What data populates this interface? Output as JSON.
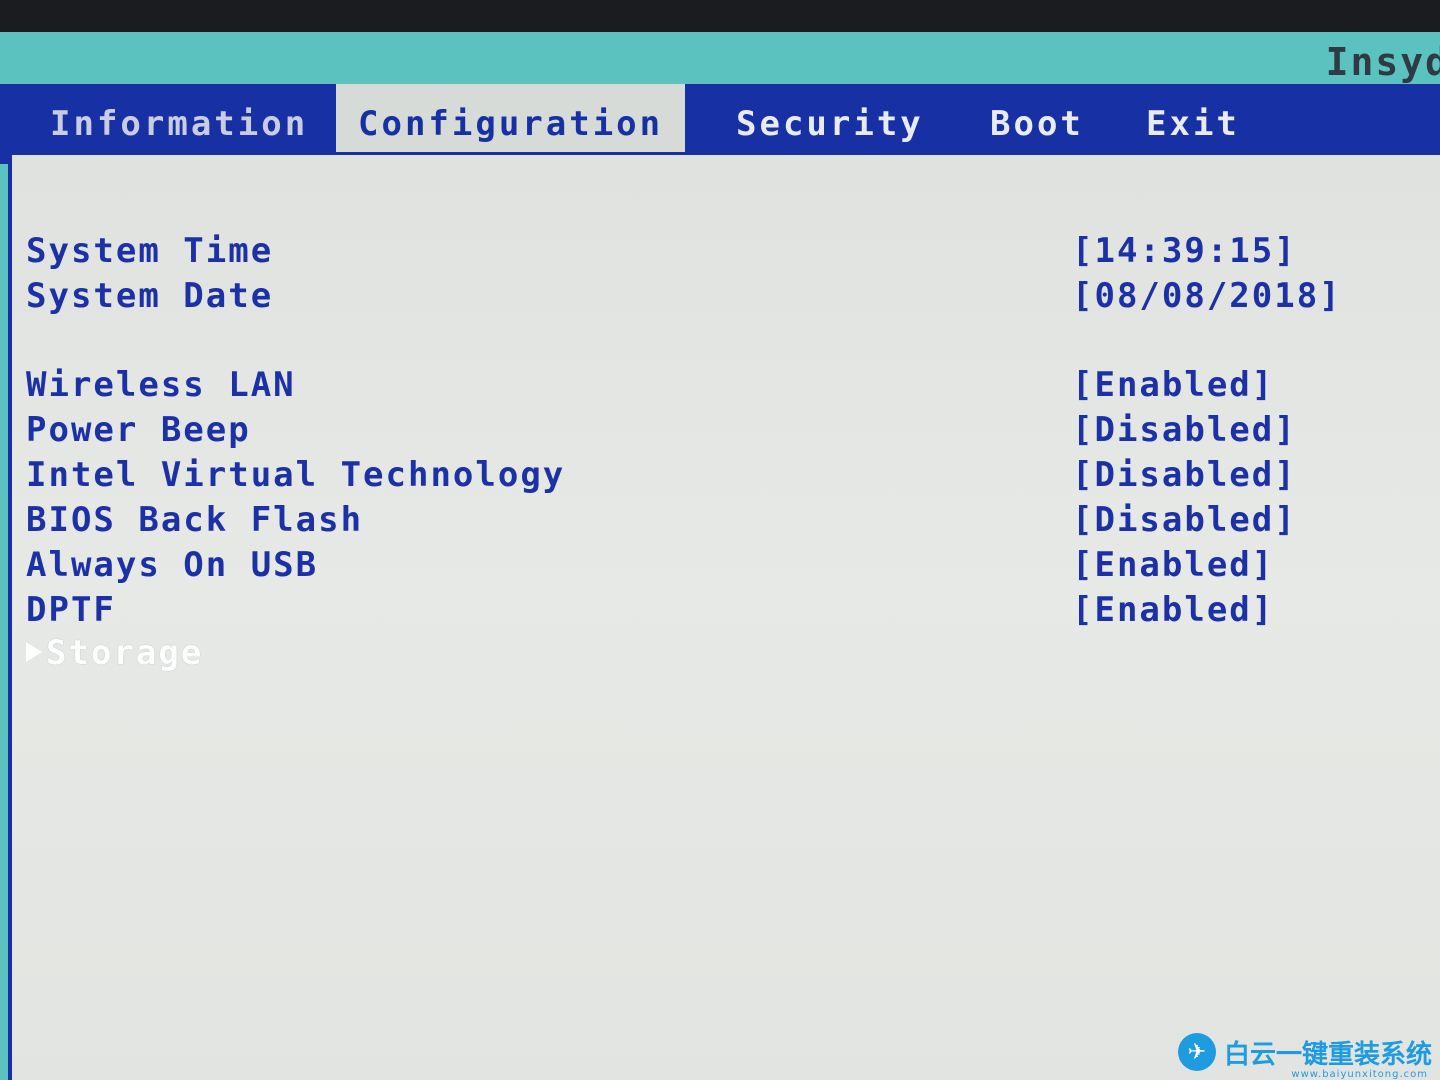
{
  "vendor": "Insyd",
  "tabs": [
    {
      "label": "Information",
      "active": false
    },
    {
      "label": "Configuration",
      "active": true
    },
    {
      "label": "Security",
      "active": false
    },
    {
      "label": "Boot",
      "active": false
    },
    {
      "label": "Exit",
      "active": false
    }
  ],
  "settings": [
    {
      "label": "System Time",
      "value": "[14:39:15]"
    },
    {
      "label": "System Date",
      "value": "[08/08/2018]"
    },
    {
      "label": "Wireless LAN",
      "value": "[Enabled]"
    },
    {
      "label": "Power Beep",
      "value": "[Disabled]"
    },
    {
      "label": "Intel Virtual Technology",
      "value": "[Disabled]"
    },
    {
      "label": "BIOS Back Flash",
      "value": "[Disabled]"
    },
    {
      "label": "Always On USB",
      "value": "[Enabled]"
    },
    {
      "label": "DPTF",
      "value": "[Enabled]"
    },
    {
      "label": "Storage",
      "value": ""
    }
  ],
  "watermark": {
    "text": "白云一键重装系统",
    "url": "www.baiyunxitong.com"
  },
  "colors": {
    "menubar": "#1730a4",
    "text": "#1c31a6",
    "panel": "#e2e4e1",
    "header": "#5cc2bf"
  }
}
